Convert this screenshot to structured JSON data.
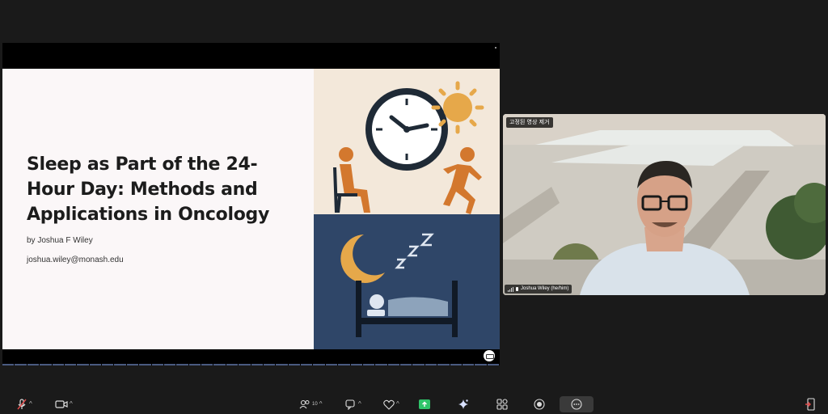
{
  "slide": {
    "title": "Sleep as Part of the 24-\nHour Day: Methods and\nApplications in Oncology",
    "author": "by Joshua F Wiley",
    "email": "joshua.wiley@monash.edu"
  },
  "video": {
    "pin_badge": "고정된 영상 제거",
    "participant_name": "Joshua Wiley (he/him)"
  },
  "toolbar": {
    "participants_count": "10",
    "caret": "^"
  },
  "colors": {
    "slide_top_bg": "#f3e8da",
    "slide_bottom_bg": "#2f4668",
    "figure_orange": "#d3782e",
    "sun_yellow": "#e6a84a"
  }
}
